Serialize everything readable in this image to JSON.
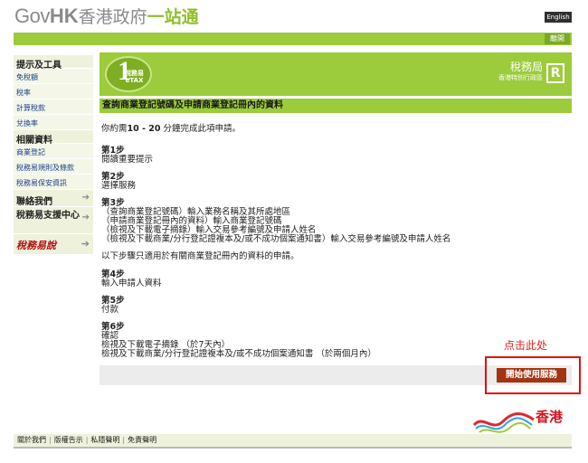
{
  "header": {
    "logo_gov": "Gov",
    "logo_hk": "HK",
    "logo_zh": "香港政府",
    "logo_one": "一站通",
    "lang_button": "English",
    "logout_button": "離開"
  },
  "sidebar": {
    "section1_title": "提示及工具",
    "section1_items": [
      "免稅額",
      "稅率",
      "計算稅款",
      "兌換率"
    ],
    "section2_title": "相關資料",
    "section2_items": [
      "商業登記",
      "稅務易規則及條款",
      "稅務易保安資訊"
    ],
    "contact_us": "聯絡我們",
    "support_centre": "稅務易支援中心",
    "script_logo": "稅務易說",
    "arrow": "➔"
  },
  "banner": {
    "etax_one": "1",
    "etax_label": "稅務易",
    "etax_en": "eTAX",
    "ird_name": "稅務局",
    "ird_sub": "香港特別行政區",
    "ird_mark": "R"
  },
  "page": {
    "title": "查詢商業登記號碼及申請商業登記冊內的資料",
    "time_prefix": "你約需",
    "time_value": "10 - 20",
    "time_suffix": " 分鐘完成此項申請。",
    "steps_a": [
      {
        "title": "第1步",
        "lines": [
          "閱讀重要提示"
        ]
      },
      {
        "title": "第2步",
        "lines": [
          "選擇服務"
        ]
      },
      {
        "title": "第3步",
        "lines": [
          "（查詢商業登記號碼）輸入業務名稱及其所處地區",
          "（申請商業登記冊內的資料）輸入商業登記號碼",
          "（檢視及下載電子摘錄）輸入交易參考編號及申請人姓名",
          "（檢視及下載商業/分行登記證複本及/或不成功個案通知書）輸入交易參考編號及申請人姓名"
        ]
      }
    ],
    "note": "以下步驟只適用於有關商業登記冊內的資料的申請。",
    "steps_b": [
      {
        "title": "第4步",
        "lines": [
          "輸入申請人資料"
        ]
      },
      {
        "title": "第5步",
        "lines": [
          "付款"
        ]
      },
      {
        "title": "第6步",
        "lines": [
          "確認",
          "檢視及下載電子摘錄 （於7天內）",
          "檢視及下載商業/分行登記證複本及/或不成功個案通知書 （於兩個月內）"
        ]
      }
    ],
    "annotation": "点击此处",
    "start_button": "開始使用服務"
  },
  "brand": {
    "hk_zh": "香港"
  },
  "footer": {
    "links": [
      "關於我們",
      "版權告示",
      "私隱聲明",
      "免責聲明"
    ],
    "separator": "|"
  },
  "colors": {
    "green": "#9ccb3b",
    "button_red": "#a33410",
    "annotation_red": "#e02020"
  }
}
